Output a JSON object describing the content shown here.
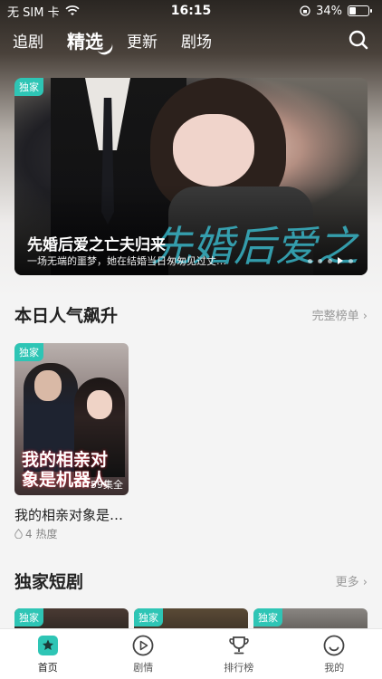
{
  "status_bar": {
    "carrier": "无 SIM 卡",
    "time": "16:15",
    "battery_percent": "34%",
    "battery_level": 0.34
  },
  "nav": {
    "tabs": [
      {
        "label": "追剧",
        "active": false
      },
      {
        "label": "精选",
        "active": true
      },
      {
        "label": "更新",
        "active": false
      },
      {
        "label": "剧场",
        "active": false
      }
    ]
  },
  "banner": {
    "badge": "独家",
    "title": "先婚后爱之亡夫归来",
    "subtitle": "一场无端的噩梦，她在结婚当日匆匆见过丈…",
    "art_text": "先婚后爱之"
  },
  "popular": {
    "title": "本日人气飙升",
    "more": "完整榜单",
    "items": [
      {
        "badge": "独家",
        "title": "我的相亲对象是…",
        "heat": "4 热度",
        "status": "59集全",
        "poster_text": "我的相亲对象是机器人"
      }
    ]
  },
  "exclusive": {
    "title": "独家短剧",
    "more": "更多",
    "items": [
      {
        "badge": "独家"
      },
      {
        "badge": "独家"
      },
      {
        "badge": "独家"
      }
    ]
  },
  "tabbar": {
    "items": [
      {
        "label": "首页",
        "icon": "home-icon",
        "active": true
      },
      {
        "label": "剧情",
        "icon": "play-circle-icon",
        "active": false
      },
      {
        "label": "排行榜",
        "icon": "trophy-icon",
        "active": false
      },
      {
        "label": "我的",
        "icon": "profile-icon",
        "active": false
      }
    ]
  },
  "colors": {
    "accent": "#2ec5b5",
    "badge_bg": "#2ec5b5"
  }
}
